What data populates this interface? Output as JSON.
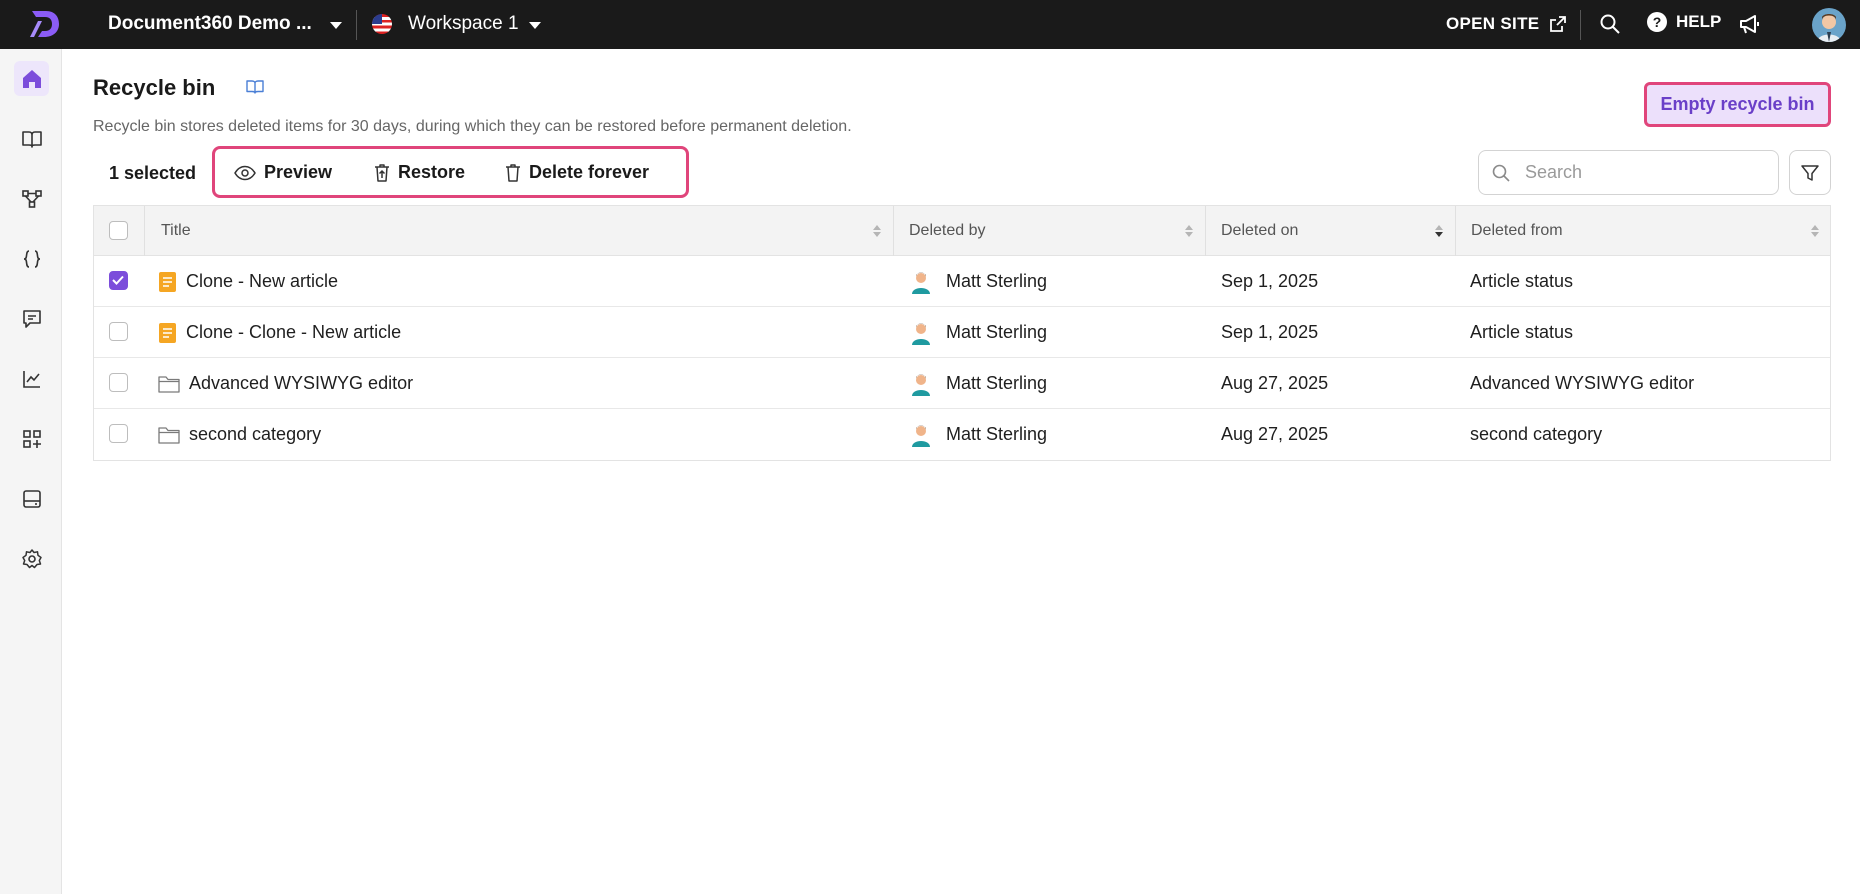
{
  "topbar": {
    "project": "Document360 Demo ...",
    "workspace": "Workspace 1",
    "open_site": "OPEN SITE",
    "help": "HELP",
    "help_glyph": "?"
  },
  "page": {
    "title": "Recycle bin",
    "subtitle": "Recycle bin stores deleted items for 30 days, during which they can be restored before permanent deletion.",
    "empty_button": "Empty recycle bin"
  },
  "toolbar": {
    "selected": "1 selected",
    "preview": "Preview",
    "restore": "Restore",
    "delete_forever": "Delete forever",
    "search_placeholder": "Search"
  },
  "table": {
    "headers": {
      "title": "Title",
      "deleted_by": "Deleted by",
      "deleted_on": "Deleted on",
      "deleted_from": "Deleted from"
    },
    "rows": [
      {
        "title": "Clone - New article",
        "type": "article",
        "checked": true,
        "deleted_by": "Matt Sterling",
        "deleted_on": "Sep 1, 2025",
        "deleted_from": "Article status"
      },
      {
        "title": "Clone - Clone - New article",
        "type": "article",
        "checked": false,
        "deleted_by": "Matt Sterling",
        "deleted_on": "Sep 1, 2025",
        "deleted_from": "Article status"
      },
      {
        "title": "Advanced WYSIWYG editor",
        "type": "category",
        "checked": false,
        "deleted_by": "Matt Sterling",
        "deleted_on": "Aug 27, 2025",
        "deleted_from": "Advanced WYSIWYG editor"
      },
      {
        "title": "second category",
        "type": "category",
        "checked": false,
        "deleted_by": "Matt Sterling",
        "deleted_on": "Aug 27, 2025",
        "deleted_from": "second category"
      }
    ]
  },
  "sidebar": {
    "items": [
      "home-icon",
      "book-icon",
      "hierarchy-icon",
      "braces-icon",
      "comment-icon",
      "analytics-icon",
      "add-apps-icon",
      "widget-icon",
      "settings-icon"
    ]
  },
  "colors": {
    "accent": "#7c4ddb",
    "highlight": "#e0457b",
    "topbar": "#1a1a1a",
    "article_icon": "#f5a623"
  }
}
